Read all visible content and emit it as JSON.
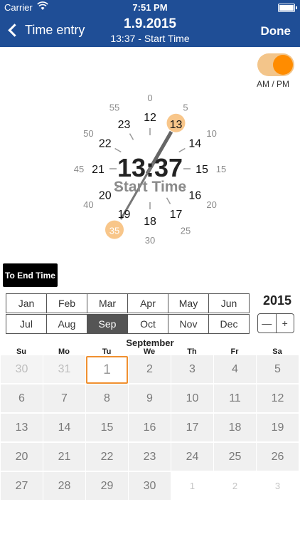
{
  "status": {
    "carrier": "Carrier",
    "time": "7:51 PM"
  },
  "nav": {
    "back_label": "Time entry",
    "title": "1.9.2015",
    "subtitle": "13:37 - Start Time",
    "done_label": "Done"
  },
  "toggle": {
    "label": "AM / PM",
    "on": true
  },
  "clock": {
    "hours_inner": [
      "12",
      "13",
      "14",
      "15",
      "16",
      "17",
      "18",
      "19",
      "20",
      "21",
      "22",
      "23"
    ],
    "minutes_outer": [
      "0",
      "5",
      "10",
      "15",
      "20",
      "25",
      "30",
      "35",
      "40",
      "45",
      "50",
      "55"
    ],
    "selected_hour": "13",
    "selected_minute": "35",
    "time": "13:37",
    "mode_label": "Start Time",
    "accent": "#f8c68a"
  },
  "end_button_label": "To End Time",
  "months": [
    "Jan",
    "Feb",
    "Mar",
    "Apr",
    "May",
    "Jun",
    "Jul",
    "Aug",
    "Sep",
    "Oct",
    "Nov",
    "Dec"
  ],
  "selected_month": "Sep",
  "year": "2015",
  "stepper": {
    "minus": "—",
    "plus": "+"
  },
  "calendar": {
    "month_name": "September",
    "weekdays": [
      "Su",
      "Mo",
      "Tu",
      "We",
      "Th",
      "Fr",
      "Sa"
    ],
    "rows": [
      [
        "30",
        "31",
        "1",
        "2",
        "3",
        "4",
        "5"
      ],
      [
        "6",
        "7",
        "8",
        "9",
        "10",
        "11",
        "12"
      ],
      [
        "13",
        "14",
        "15",
        "16",
        "17",
        "18",
        "19"
      ],
      [
        "20",
        "21",
        "22",
        "23",
        "24",
        "25",
        "26"
      ],
      [
        "27",
        "28",
        "29",
        "30",
        "1",
        "2",
        "3"
      ]
    ],
    "selected_day": "1"
  }
}
